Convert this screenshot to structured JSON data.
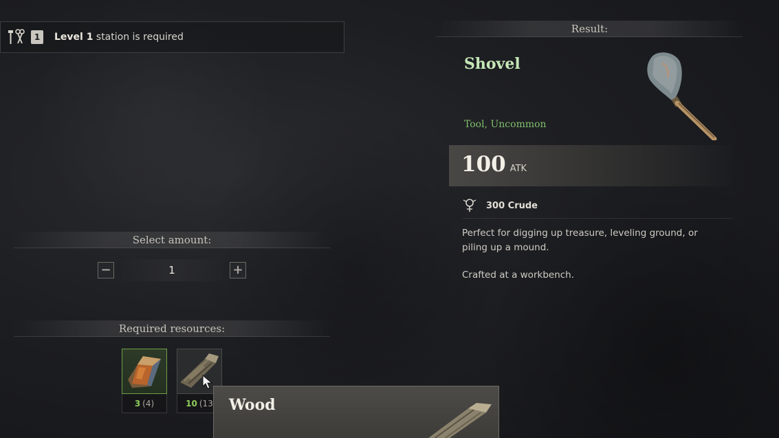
{
  "requirement": {
    "level_badge": "1",
    "level_label": "Level 1",
    "text": " station is required"
  },
  "amount": {
    "section_title": "Select amount:",
    "value": "1",
    "minus_label": "−",
    "plus_label": "+"
  },
  "resources": {
    "section_title": "Required resources:",
    "items": [
      {
        "icon": "metal-ingot-icon",
        "have": "3",
        "need": "(4)"
      },
      {
        "icon": "wood-icon",
        "have": "10",
        "need": "(13"
      }
    ]
  },
  "result": {
    "section_title": "Result:",
    "name": "Shovel",
    "type": "Tool, Uncommon",
    "stat_value": "100",
    "stat_unit": "ATK",
    "quality_icon": "crude-quality-icon",
    "quality": "300 Crude",
    "description": "Perfect for digging up treasure, leveling ground, or piling up a mound.",
    "note": "Crafted at a workbench."
  },
  "tooltip": {
    "title": "Wood"
  },
  "colors": {
    "item_name": "#c6e7b8",
    "item_type": "#7fbf6c",
    "resource_have": "#8fcf5c",
    "slot_ok_border": "#6fa048"
  }
}
